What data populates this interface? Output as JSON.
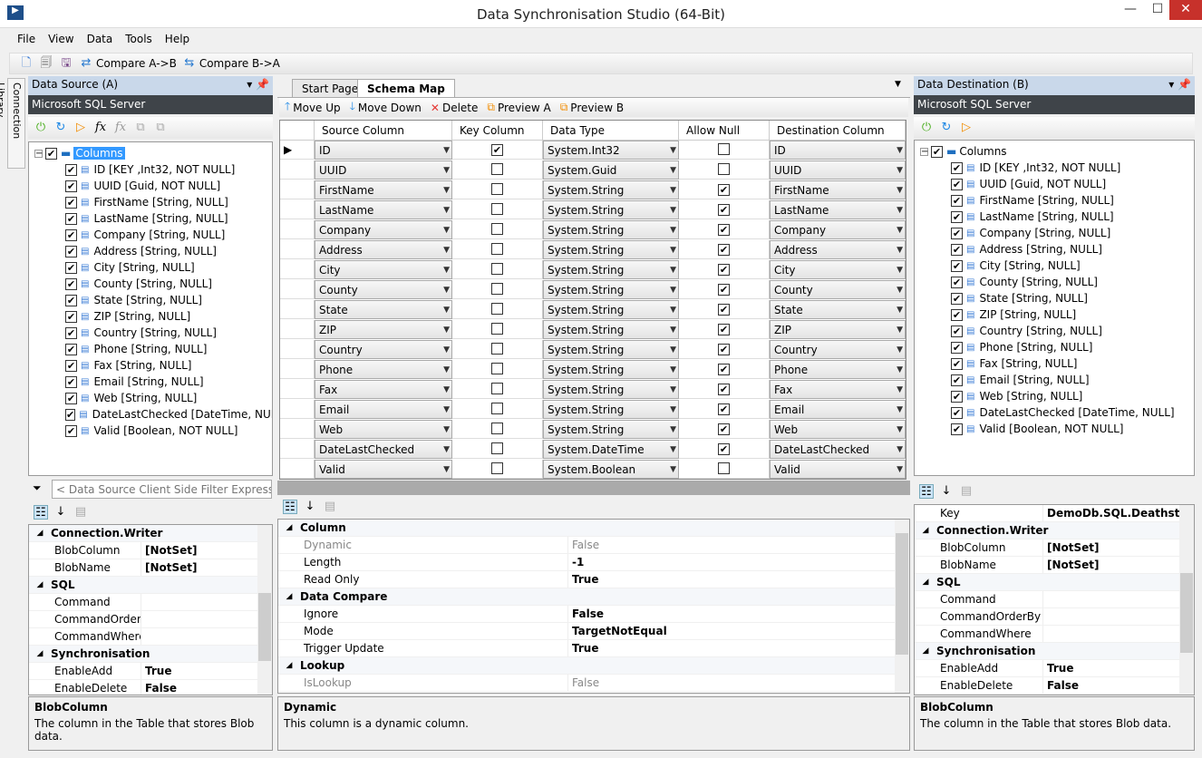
{
  "window": {
    "title": "Data Synchronisation Studio (64-Bit)",
    "minimize": "—",
    "maximize": "☐",
    "close": "✕"
  },
  "menu": [
    "File",
    "View",
    "Data",
    "Tools",
    "Help"
  ],
  "toolbar": {
    "compare_ab": "Compare A->B",
    "compare_ba": "Compare B->A"
  },
  "side_tab": "Connection Library",
  "source": {
    "title": "Data Source (A)",
    "provider": "Microsoft SQL Server",
    "root": "Columns",
    "items": [
      "ID [KEY ,Int32, NOT NULL]",
      "UUID [Guid, NOT NULL]",
      "FirstName [String, NULL]",
      "LastName [String, NULL]",
      "Company [String, NULL]",
      "Address [String, NULL]",
      "City [String, NULL]",
      "County [String, NULL]",
      "State [String, NULL]",
      "ZIP [String, NULL]",
      "Country [String, NULL]",
      "Phone [String, NULL]",
      "Fax [String, NULL]",
      "Email [String, NULL]",
      "Web [String, NULL]",
      "DateLastChecked [DateTime, NULL]",
      "Valid [Boolean, NOT NULL]"
    ],
    "filter_placeholder": "< Data Source Client Side Filter Expression >",
    "props": [
      {
        "cat": "Connection.Writer"
      },
      {
        "k": "BlobColumn",
        "v": "[NotSet]"
      },
      {
        "k": "BlobName",
        "v": "[NotSet]"
      },
      {
        "cat": "SQL"
      },
      {
        "k": "Command",
        "v": ""
      },
      {
        "k": "CommandOrderBy",
        "v": ""
      },
      {
        "k": "CommandWhere",
        "v": ""
      },
      {
        "cat": "Synchronisation"
      },
      {
        "k": "EnableAdd",
        "v": "True"
      },
      {
        "k": "EnableDelete",
        "v": "False"
      }
    ],
    "desc_title": "BlobColumn",
    "desc_text": "The column in the Table that stores Blob data."
  },
  "center": {
    "tabs": [
      "Start Page",
      "Schema Map"
    ],
    "active_tab": "Schema Map",
    "tools": [
      "Move Up",
      "Move Down",
      "Delete",
      "Preview A",
      "Preview B"
    ],
    "headers": [
      "Source Column",
      "Key Column",
      "Data Type",
      "Allow Null",
      "Destination Column"
    ],
    "rows": [
      [
        "ID",
        true,
        "System.Int32",
        false,
        "ID"
      ],
      [
        "UUID",
        false,
        "System.Guid",
        false,
        "UUID"
      ],
      [
        "FirstName",
        false,
        "System.String",
        true,
        "FirstName"
      ],
      [
        "LastName",
        false,
        "System.String",
        true,
        "LastName"
      ],
      [
        "Company",
        false,
        "System.String",
        true,
        "Company"
      ],
      [
        "Address",
        false,
        "System.String",
        true,
        "Address"
      ],
      [
        "City",
        false,
        "System.String",
        true,
        "City"
      ],
      [
        "County",
        false,
        "System.String",
        true,
        "County"
      ],
      [
        "State",
        false,
        "System.String",
        true,
        "State"
      ],
      [
        "ZIP",
        false,
        "System.String",
        true,
        "ZIP"
      ],
      [
        "Country",
        false,
        "System.String",
        true,
        "Country"
      ],
      [
        "Phone",
        false,
        "System.String",
        true,
        "Phone"
      ],
      [
        "Fax",
        false,
        "System.String",
        true,
        "Fax"
      ],
      [
        "Email",
        false,
        "System.String",
        true,
        "Email"
      ],
      [
        "Web",
        false,
        "System.String",
        true,
        "Web"
      ],
      [
        "DateLastChecked",
        false,
        "System.DateTime",
        true,
        "DateLastChecked"
      ],
      [
        "Valid",
        false,
        "System.Boolean",
        false,
        "Valid"
      ]
    ],
    "props": [
      {
        "cat": "Column"
      },
      {
        "k": "Dynamic",
        "v": "False",
        "dim": true
      },
      {
        "k": "Length",
        "v": "-1"
      },
      {
        "k": "Read Only",
        "v": "True"
      },
      {
        "cat": "Data Compare"
      },
      {
        "k": "Ignore",
        "v": "False"
      },
      {
        "k": "Mode",
        "v": "TargetNotEqual"
      },
      {
        "k": "Trigger Update",
        "v": "True"
      },
      {
        "cat": "Lookup"
      },
      {
        "k": "IsLookup",
        "v": "False",
        "dim": true
      }
    ],
    "desc_title": "Dynamic",
    "desc_text": "This column is a dynamic column."
  },
  "dest": {
    "title": "Data Destination (B)",
    "provider": "Microsoft SQL Server",
    "root": "Columns",
    "items": [
      "ID [KEY ,Int32, NOT NULL]",
      "UUID [Guid, NOT NULL]",
      "FirstName [String, NULL]",
      "LastName [String, NULL]",
      "Company [String, NULL]",
      "Address [String, NULL]",
      "City [String, NULL]",
      "County [String, NULL]",
      "State [String, NULL]",
      "ZIP [String, NULL]",
      "Country [String, NULL]",
      "Phone [String, NULL]",
      "Fax [String, NULL]",
      "Email [String, NULL]",
      "Web [String, NULL]",
      "DateLastChecked [DateTime, NULL]",
      "Valid [Boolean, NOT NULL]"
    ],
    "props": [
      {
        "k": "Key",
        "v": "DemoDb.SQL.Deathstar"
      },
      {
        "cat": "Connection.Writer"
      },
      {
        "k": "BlobColumn",
        "v": "[NotSet]"
      },
      {
        "k": "BlobName",
        "v": "[NotSet]"
      },
      {
        "cat": "SQL"
      },
      {
        "k": "Command",
        "v": ""
      },
      {
        "k": "CommandOrderBy",
        "v": ""
      },
      {
        "k": "CommandWhere",
        "v": ""
      },
      {
        "cat": "Synchronisation"
      },
      {
        "k": "EnableAdd",
        "v": "True"
      },
      {
        "k": "EnableDelete",
        "v": "False"
      }
    ],
    "desc_title": "BlobColumn",
    "desc_text": "The column in the Table that stores Blob data."
  },
  "colors": {
    "header_blue": "#c9d8ea",
    "provider_bar": "#3f4449",
    "selection": "#3399ff"
  }
}
